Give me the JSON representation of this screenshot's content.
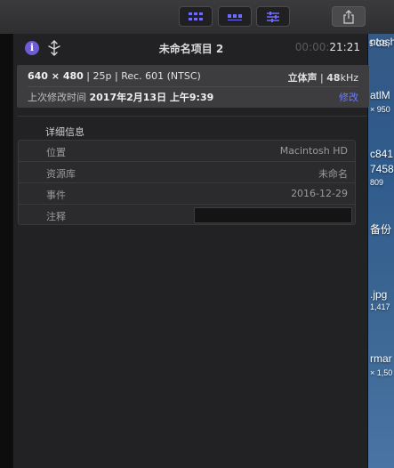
{
  "toolbar": {
    "buttons": [
      "grid-view-icon",
      "list-view-icon",
      "sliders-icon"
    ],
    "share": "share-icon",
    "accent": "#6e6cff"
  },
  "header": {
    "title": "未命名项目 2",
    "timecode_dim": "00:00:",
    "timecode_bright": "21:21"
  },
  "summary": {
    "resolution": "640 × 480",
    "format_rest": " | 25p | Rec. 601 (NTSC)",
    "audio_label": "立体声",
    "audio_rate": "48",
    "audio_unit": "kHz",
    "modified_label": "上次修改时间 ",
    "modified_value": "2017年2月13日 上午9:39",
    "modify_link": "修改"
  },
  "details": {
    "heading": "详细信息",
    "rows": [
      {
        "label": "位置",
        "value": "Macintosh HD"
      },
      {
        "label": "资源库",
        "value": "未命名"
      },
      {
        "label": "事件",
        "value": "2016-12-29"
      },
      {
        "label": "注释",
        "value": ""
      }
    ]
  },
  "desktop_fragments": [
    "ntosh",
    "5 GB,",
    "atlM",
    "× 950",
    "c841",
    "7458",
    "809",
    "备份",
    ".jpg",
    "1,417",
    "rmar",
    "× 1,50"
  ]
}
